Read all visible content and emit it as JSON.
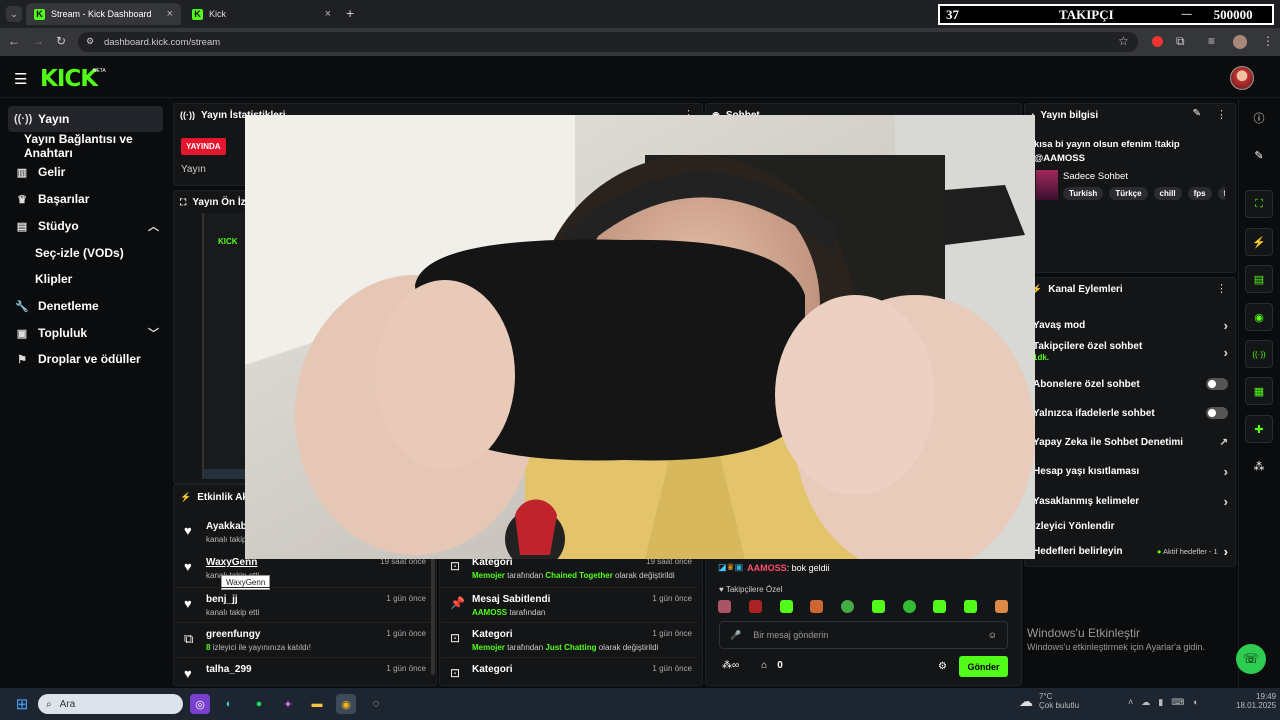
{
  "browser": {
    "tabs": [
      {
        "label": "Stream - Kick Dashboard",
        "active": true
      },
      {
        "label": "Kick",
        "active": false
      }
    ],
    "url": "dashboard.kick.com/stream"
  },
  "follower_goal": {
    "current": "37",
    "label": "TAKIPÇI",
    "target": "500000"
  },
  "header": {
    "logo": "KICK",
    "badge": "BETA"
  },
  "sidebar": {
    "items": [
      {
        "label": "Yayın",
        "icon": "broadcast-icon"
      },
      {
        "label": "Yayın Bağlantısı ve Anahtarı",
        "icon": ""
      },
      {
        "label": "Gelir",
        "icon": "chart-icon"
      },
      {
        "label": "Başarılar",
        "icon": "trophy-icon"
      },
      {
        "label": "Stüdyo",
        "icon": "studio-icon"
      },
      {
        "label": "Seç-izle (VODs)",
        "icon": ""
      },
      {
        "label": "Klipler",
        "icon": ""
      },
      {
        "label": "Denetleme",
        "icon": "wrench-icon"
      },
      {
        "label": "Topluluk",
        "icon": "community-icon"
      },
      {
        "label": "Droplar ve ödüller",
        "icon": "gift-icon"
      }
    ]
  },
  "stats": {
    "title": "Yayın İstatistikleri",
    "live_badge": "YAYINDA",
    "stream_label": "Yayın"
  },
  "preview": {
    "title": "Yayın Ön İzleme"
  },
  "chat": {
    "title": "Sohbet",
    "last_message": {
      "user": "AAMOSS",
      "text": ": bok geldii"
    },
    "follower_only": "Takipçilere Özel",
    "input_placeholder": "Bir mesaj gönderin",
    "viewers": "0",
    "send_label": "Gönder"
  },
  "activity": {
    "title": "Etkinlik Akışı",
    "items": [
      {
        "name": "Ayakkab",
        "sub": "kanalı takip etti",
        "time": ""
      },
      {
        "name": "WaxyGenn",
        "sub": "kanalı takip etti",
        "time": "19 saat önce"
      },
      {
        "name": "benj_jj",
        "sub": "kanalı takip etti",
        "time": "1 gün önce"
      },
      {
        "name": "greenfungy",
        "sub_count": "8",
        "sub": " izleyici ile yayınınıza katıldı!",
        "time": "1 gün önce"
      },
      {
        "name": "talha_299",
        "sub": "kanalı takip etti",
        "time": "1 gün önce"
      }
    ],
    "tooltip": "WaxyGenn"
  },
  "mod_feed": {
    "items": [
      {
        "title": "Kategori",
        "actor": "Memojer",
        "mid": " tarafından ",
        "target": "Chained Together",
        "end": " olarak değiştirildi",
        "time": "19 saat önce"
      },
      {
        "title": "Mesaj Sabitlendi",
        "actor": "AAMOSS",
        "mid": " tarafından",
        "target": "",
        "end": "",
        "time": "1 gün önce"
      },
      {
        "title": "Kategori",
        "actor": "Memojer",
        "mid": " tarafından ",
        "target": "Just Chatting",
        "end": " olarak değiştirildi",
        "time": "1 gün önce"
      },
      {
        "title": "Kategori",
        "actor": "",
        "mid": "",
        "target": "",
        "end": "",
        "time": "1 gün önce"
      }
    ]
  },
  "stream_info": {
    "title": "Yayın bilgisi",
    "stream_title": "kısa bi yayın olsun efenim !takip @AAMOSS",
    "category": "Sadece Sohbet",
    "tags": [
      "Turkish",
      "Türkçe",
      "chill",
      "fps",
      "fu"
    ]
  },
  "channel_actions": {
    "title": "Kanal Eylemleri",
    "items": [
      {
        "label": "Yavaş mod",
        "control": "arrow"
      },
      {
        "label": "Takipçilere özel sohbet",
        "sub": "1dk.",
        "control": "arrow"
      },
      {
        "label": "Abonelere özel sohbet",
        "control": "toggle"
      },
      {
        "label": "Yalnızca ifadelerle sohbet",
        "control": "toggle"
      },
      {
        "label": "Yapay Zeka ile Sohbet Denetimi",
        "control": "external"
      },
      {
        "label": "Hesap yaşı kısıtlaması",
        "control": "arrow"
      },
      {
        "label": "Yasaklanmış kelimeler",
        "control": "arrow"
      },
      {
        "label": "İzleyici Yönlendir",
        "control": "none"
      },
      {
        "label": "Hedefleri belirleyin",
        "extra": "Aktif hedefler - 1",
        "control": "arrow"
      }
    ]
  },
  "windows_watermark": {
    "title": "Windows'u Etkinleştir",
    "sub": "Windows'u etkinleştirmek için Ayarlar'a gidin."
  },
  "taskbar": {
    "search_placeholder": "Ara",
    "weather_temp": "7°C",
    "weather_text": "Çok bulutlu",
    "time": "19:49",
    "date": "18.01.2025"
  },
  "colors": {
    "accent": "#53fc18",
    "live": "#e5152d",
    "bg": "#0b0c0d",
    "panel": "#141517"
  }
}
